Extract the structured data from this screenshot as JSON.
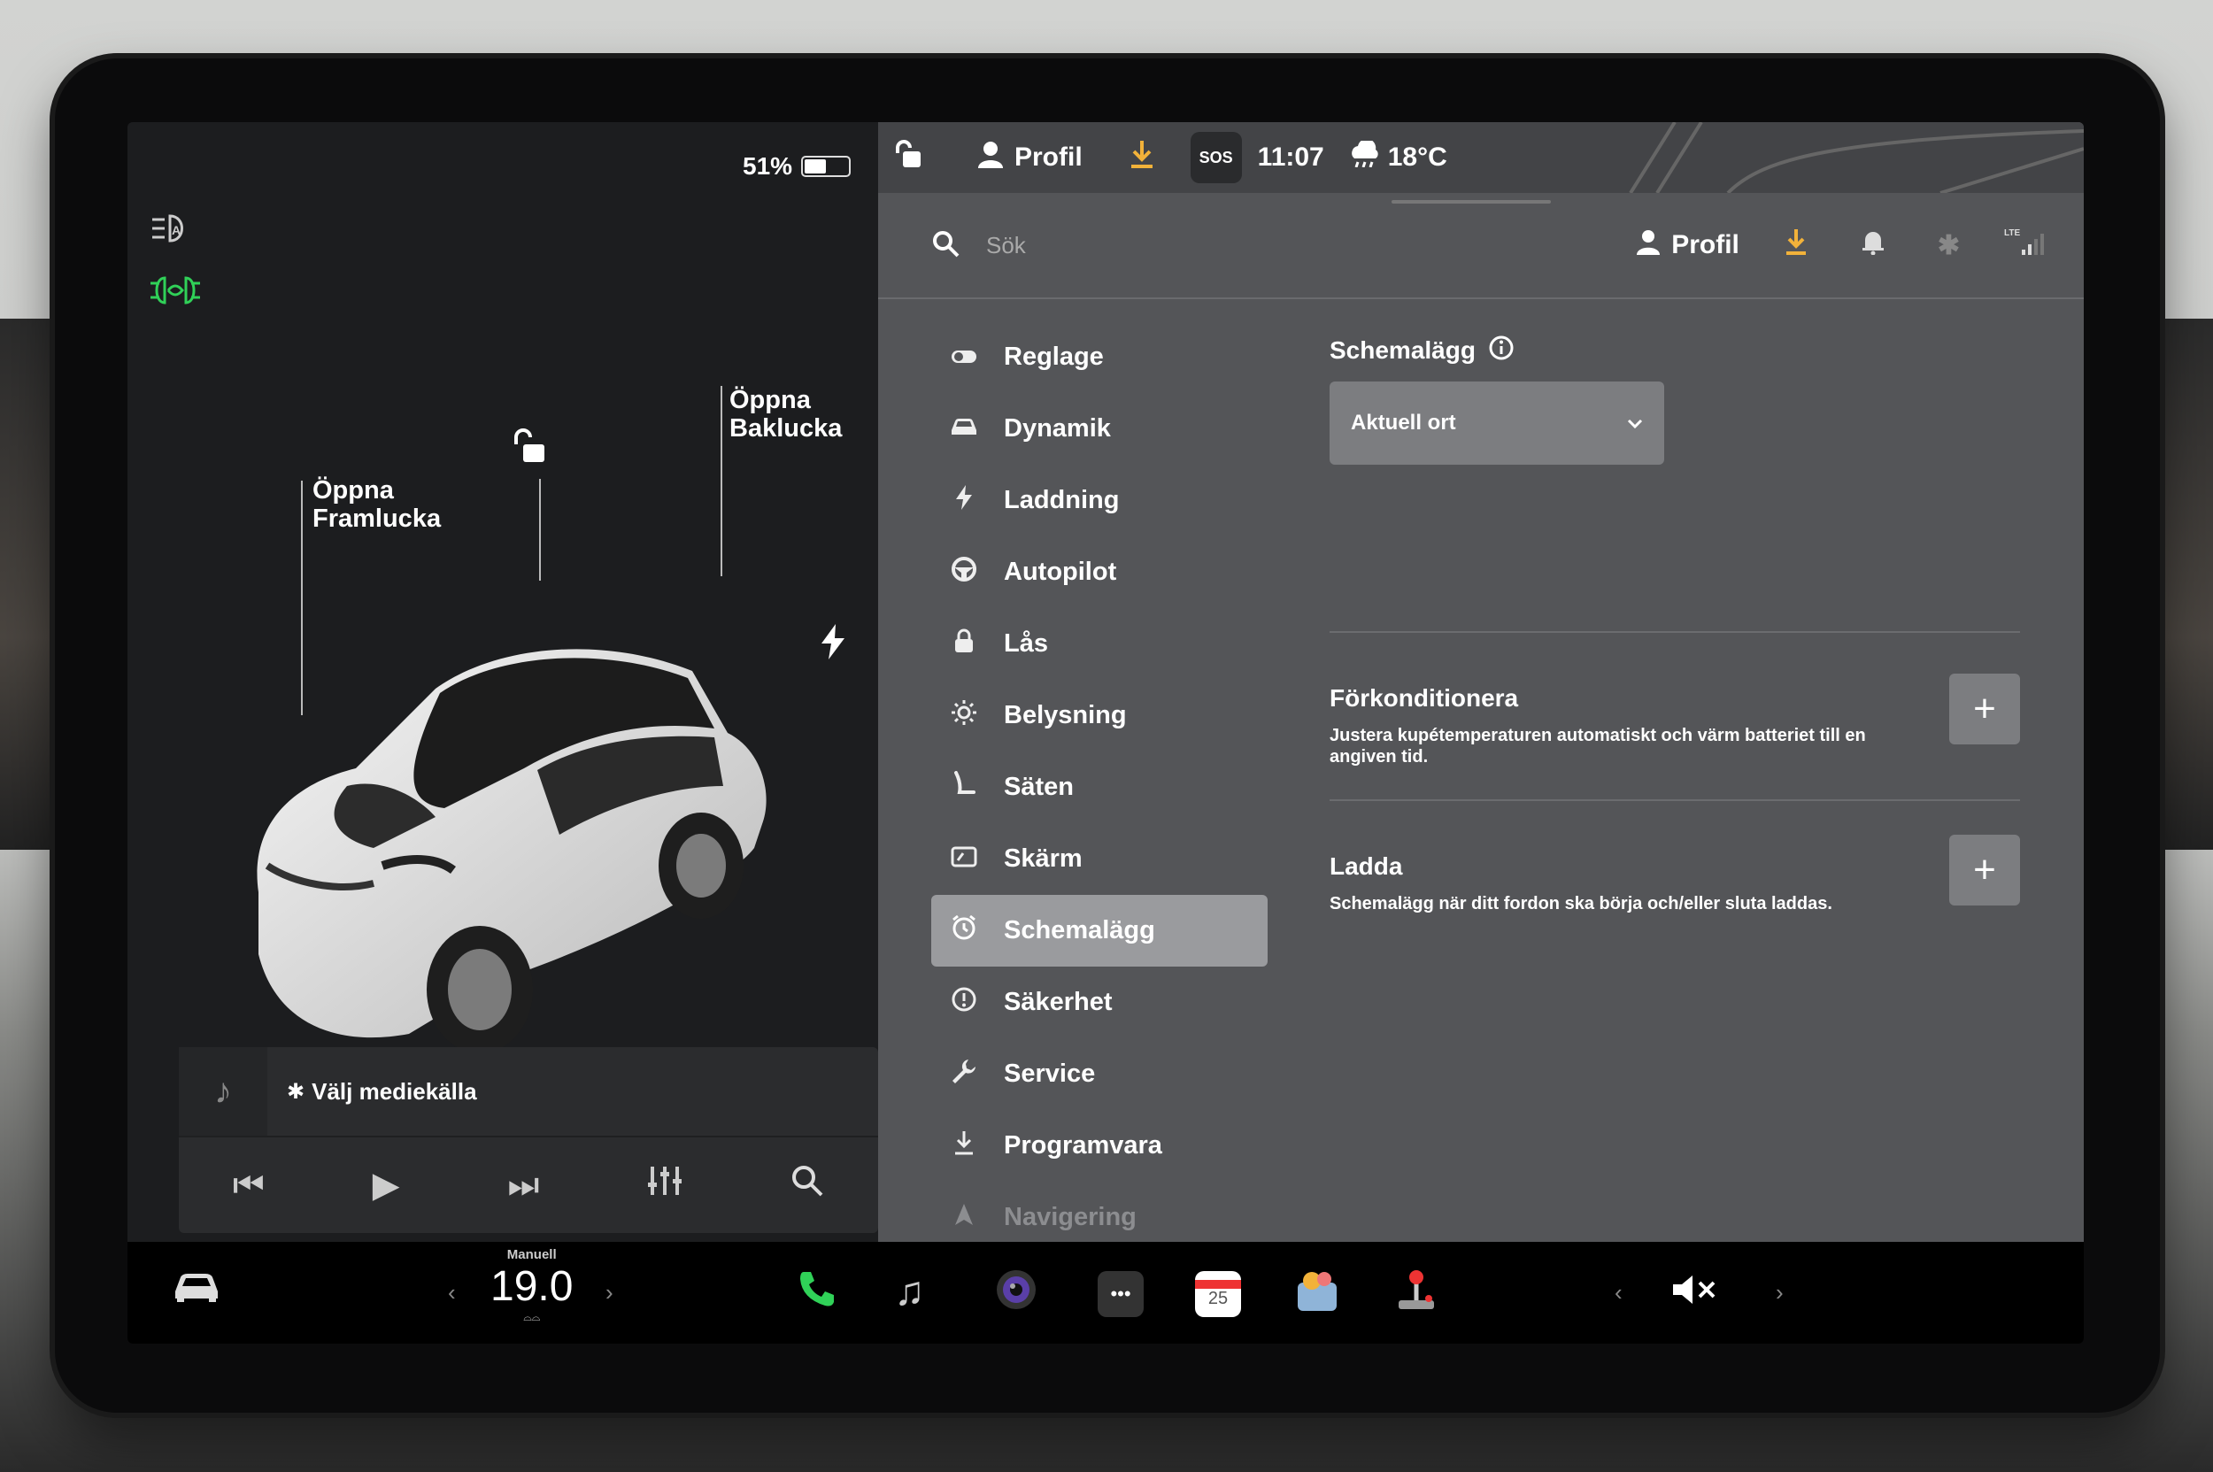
{
  "status": {
    "battery_percent": "51%",
    "battery_level": 0.51,
    "profile_label": "Profil",
    "sos_label": "SOS",
    "time": "11:07",
    "temperature": "18°C"
  },
  "car_panel": {
    "open_frunk": "Öppna\nFramlucka",
    "open_trunk": "Öppna\nBaklucka"
  },
  "search": {
    "placeholder": "Sök",
    "profile_label": "Profil"
  },
  "menu": {
    "items": [
      {
        "label": "Reglage",
        "icon": "toggle-icon"
      },
      {
        "label": "Dynamik",
        "icon": "car-icon"
      },
      {
        "label": "Laddning",
        "icon": "bolt-icon"
      },
      {
        "label": "Autopilot",
        "icon": "steering-wheel-icon"
      },
      {
        "label": "Lås",
        "icon": "lock-icon"
      },
      {
        "label": "Belysning",
        "icon": "sun-icon"
      },
      {
        "label": "Säten",
        "icon": "seat-icon"
      },
      {
        "label": "Skärm",
        "icon": "display-icon"
      },
      {
        "label": "Schemalägg",
        "icon": "alarm-clock-icon",
        "active": true
      },
      {
        "label": "Säkerhet",
        "icon": "alert-circle-icon"
      },
      {
        "label": "Service",
        "icon": "wrench-icon"
      },
      {
        "label": "Programvara",
        "icon": "download-icon"
      },
      {
        "label": "Navigering",
        "icon": "navigation-icon"
      }
    ]
  },
  "schedule": {
    "title": "Schemalägg",
    "location_value": "Aktuell ort",
    "precondition_title": "Förkonditionera",
    "precondition_desc": "Justera kupétemperaturen automatiskt och värm batteriet till en angiven tid.",
    "charge_title": "Ladda",
    "charge_desc": "Schemalägg när ditt fordon ska börja och/eller sluta laddas."
  },
  "media": {
    "source_label": "Välj mediekälla"
  },
  "taskbar": {
    "climate_mode": "Manuell",
    "temperature": "19.0",
    "calendar_day": "25"
  },
  "colors": {
    "accent_yellow": "#f2b23a",
    "headlight_green": "#30d158",
    "active_menu": "#9a9b9e"
  }
}
